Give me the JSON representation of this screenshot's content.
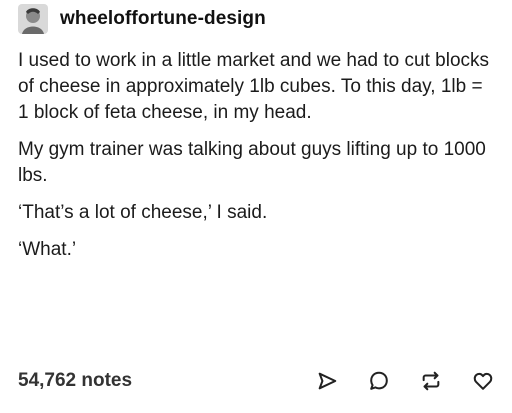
{
  "post": {
    "username": "wheeloffortune-design",
    "paragraphs": [
      "I used to work in a little market and we had to cut blocks of cheese in approximately 1lb cubes. To this day, 1lb = 1 block of feta cheese, in my head.",
      "My gym trainer was talking about guys lifting up to 1000 lbs.",
      "‘That’s a lot of cheese,’ I said.",
      "‘What.’"
    ],
    "notes": "54,762 notes"
  },
  "icons": {
    "avatar": "user-avatar",
    "share": "share-icon",
    "reply": "reply-icon",
    "reblog": "reblog-icon",
    "like": "heart-icon"
  },
  "colors": {
    "text": "#1b1b1b",
    "background": "#ffffff"
  }
}
